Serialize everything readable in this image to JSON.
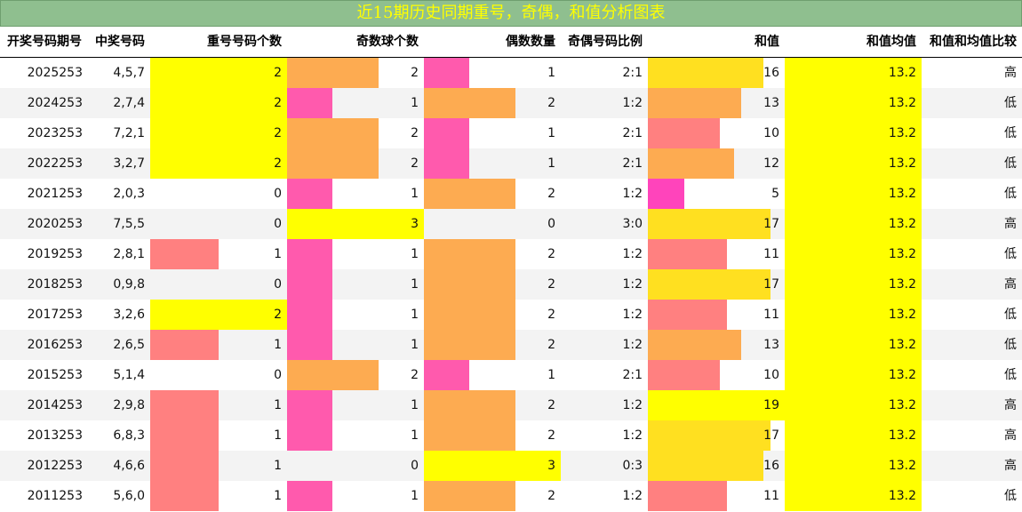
{
  "title": "近15期历史同期重号，奇偶，和值分析图表",
  "headers": [
    "开奖号码期号",
    "中奖号码",
    "重号号码个数",
    "奇数球个数",
    "偶数数量",
    "奇偶号码比例",
    "和值",
    "和值均值",
    "和值和均值比较"
  ],
  "colors": {
    "yellow": "#ffff00",
    "orange": "#fdab51",
    "pink": "#ff5aad",
    "salmon": "#ff8080",
    "gold": "#ffe020",
    "hot_pink": "#ff44bb",
    "title_bg": "#8fbf8f"
  },
  "rows": [
    {
      "period": "2025253",
      "numbers": "4,5,7",
      "repeat": "2",
      "odd": "2",
      "even": "1",
      "ratio": "2:1",
      "sum": "16",
      "avg": "13.2",
      "cmp": "高"
    },
    {
      "period": "2024253",
      "numbers": "2,7,4",
      "repeat": "2",
      "odd": "1",
      "even": "2",
      "ratio": "1:2",
      "sum": "13",
      "avg": "13.2",
      "cmp": "低"
    },
    {
      "period": "2023253",
      "numbers": "7,2,1",
      "repeat": "2",
      "odd": "2",
      "even": "1",
      "ratio": "2:1",
      "sum": "10",
      "avg": "13.2",
      "cmp": "低"
    },
    {
      "period": "2022253",
      "numbers": "3,2,7",
      "repeat": "2",
      "odd": "2",
      "even": "1",
      "ratio": "2:1",
      "sum": "12",
      "avg": "13.2",
      "cmp": "低"
    },
    {
      "period": "2021253",
      "numbers": "2,0,3",
      "repeat": "0",
      "odd": "1",
      "even": "2",
      "ratio": "1:2",
      "sum": "5",
      "avg": "13.2",
      "cmp": "低"
    },
    {
      "period": "2020253",
      "numbers": "7,5,5",
      "repeat": "0",
      "odd": "3",
      "even": "0",
      "ratio": "3:0",
      "sum": "17",
      "avg": "13.2",
      "cmp": "高"
    },
    {
      "period": "2019253",
      "numbers": "2,8,1",
      "repeat": "1",
      "odd": "1",
      "even": "2",
      "ratio": "1:2",
      "sum": "11",
      "avg": "13.2",
      "cmp": "低"
    },
    {
      "period": "2018253",
      "numbers": "0,9,8",
      "repeat": "0",
      "odd": "1",
      "even": "2",
      "ratio": "1:2",
      "sum": "17",
      "avg": "13.2",
      "cmp": "高"
    },
    {
      "period": "2017253",
      "numbers": "3,2,6",
      "repeat": "2",
      "odd": "1",
      "even": "2",
      "ratio": "1:2",
      "sum": "11",
      "avg": "13.2",
      "cmp": "低"
    },
    {
      "period": "2016253",
      "numbers": "2,6,5",
      "repeat": "1",
      "odd": "1",
      "even": "2",
      "ratio": "1:2",
      "sum": "13",
      "avg": "13.2",
      "cmp": "低"
    },
    {
      "period": "2015253",
      "numbers": "5,1,4",
      "repeat": "0",
      "odd": "2",
      "even": "1",
      "ratio": "2:1",
      "sum": "10",
      "avg": "13.2",
      "cmp": "低"
    },
    {
      "period": "2014253",
      "numbers": "2,9,8",
      "repeat": "1",
      "odd": "1",
      "even": "2",
      "ratio": "1:2",
      "sum": "19",
      "avg": "13.2",
      "cmp": "高"
    },
    {
      "period": "2013253",
      "numbers": "6,8,3",
      "repeat": "1",
      "odd": "1",
      "even": "2",
      "ratio": "1:2",
      "sum": "17",
      "avg": "13.2",
      "cmp": "高"
    },
    {
      "period": "2012253",
      "numbers": "4,6,6",
      "repeat": "1",
      "odd": "0",
      "even": "3",
      "ratio": "0:3",
      "sum": "16",
      "avg": "13.2",
      "cmp": "高"
    },
    {
      "period": "2011253",
      "numbers": "5,6,0",
      "repeat": "1",
      "odd": "1",
      "even": "2",
      "ratio": "1:2",
      "sum": "11",
      "avg": "13.2",
      "cmp": "低"
    }
  ]
}
